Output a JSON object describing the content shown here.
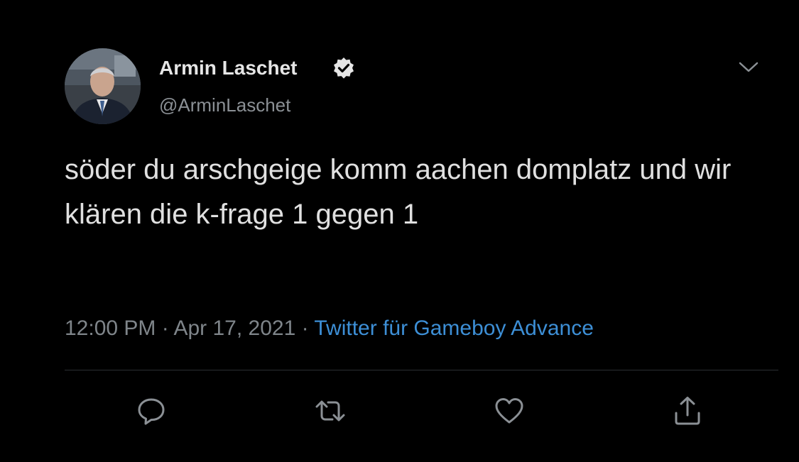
{
  "author": {
    "display_name": "Armin Laschet",
    "handle": "@ArminLaschet",
    "verified": true,
    "avatar_icon": "profile-photo"
  },
  "tweet": {
    "text": "söder du arschgeige komm aachen domplatz und wir klären die k-frage 1 gegen 1",
    "time": "12:00 PM",
    "date": "Apr 17, 2021",
    "separator": "·",
    "source": "Twitter für Gameboy Advance"
  },
  "actions": {
    "reply_icon": "speech-bubble",
    "retweet_icon": "retweet-arrows",
    "like_icon": "heart",
    "share_icon": "upload-arrow"
  },
  "colors": {
    "background": "#000000",
    "text": "#e0e0e0",
    "secondary": "#7f858a",
    "link": "#3d8fd6",
    "icon": "#8b9095"
  }
}
